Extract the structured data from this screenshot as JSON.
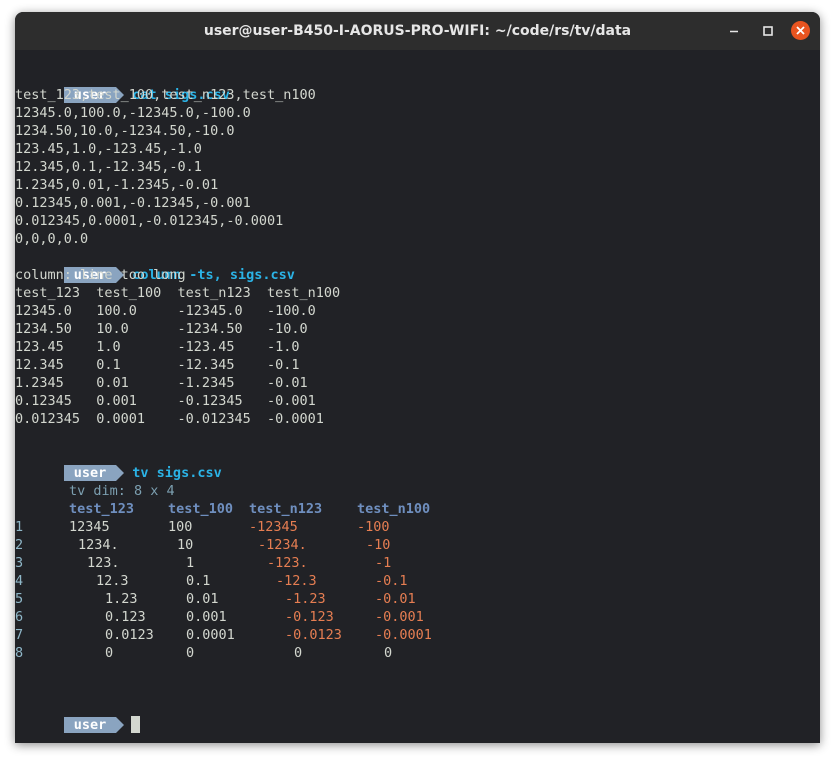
{
  "window": {
    "title": "user@user-B450-I-AORUS-PRO-WIFI: ~/code/rs/tv/data"
  },
  "prompt_user": "user",
  "commands": {
    "cat": "cat sigs.csv",
    "column": "column -ts, sigs.csv",
    "tv": "tv sigs.csv"
  },
  "cat_output": [
    "test_123,test_100,test_n123,test_n100",
    "12345.0,100.0,-12345.0,-100.0",
    "1234.50,10.0,-1234.50,-10.0",
    "123.45,1.0,-123.45,-1.0",
    "12.345,0.1,-12.345,-0.1",
    "1.2345,0.01,-1.2345,-0.01",
    "0.12345,0.001,-0.12345,-0.001",
    "0.012345,0.0001,-0.012345,-0.0001",
    "0,0,0,0.0"
  ],
  "column_warning": "column: line too long",
  "column_output": [
    "test_123  test_100  test_n123  test_n100",
    "12345.0   100.0     -12345.0   -100.0",
    "1234.50   10.0      -1234.50   -10.0",
    "123.45    1.0       -123.45    -1.0",
    "12.345    0.1       -12.345    -0.1",
    "1.2345    0.01      -1.2345    -0.01",
    "0.12345   0.001     -0.12345   -0.001",
    "0.012345  0.0001    -0.012345  -0.0001"
  ],
  "tv": {
    "dim": "tv dim: 8 x 4",
    "headers": [
      "test_123",
      "test_100",
      "test_n123",
      "test_n100"
    ],
    "rows": [
      {
        "n": "1",
        "c1": "12345",
        "c2": "100",
        "c3": "-12345",
        "c4": "-100"
      },
      {
        "n": "2",
        "c1": "1234.",
        "c2": "10",
        "c3": "-1234.",
        "c4": "-10"
      },
      {
        "n": "3",
        "c1": "123.",
        "c2": "1",
        "c3": "-123.",
        "c4": "-1"
      },
      {
        "n": "4",
        "c1": "12.3",
        "c2": "0.1",
        "c3": "-12.3",
        "c4": "-0.1"
      },
      {
        "n": "5",
        "c1": "1.23",
        "c2": "0.01",
        "c3": "-1.23",
        "c4": "-0.01"
      },
      {
        "n": "6",
        "c1": "0.123",
        "c2": "0.001",
        "c3": "-0.123",
        "c4": "-0.001"
      },
      {
        "n": "7",
        "c1": "0.0123",
        "c2": "0.0001",
        "c3": "-0.0123",
        "c4": "-0.0001"
      },
      {
        "n": "8",
        "c1": "0",
        "c2": "0",
        "c3": "0",
        "c4": "0"
      }
    ]
  },
  "colors": {
    "background": "#212226",
    "prompt_badge": "#8aa4c0",
    "command": "#2bb3e6",
    "negative": "#e67e52",
    "header": "#6f8fbf",
    "close_button": "#e95420"
  }
}
